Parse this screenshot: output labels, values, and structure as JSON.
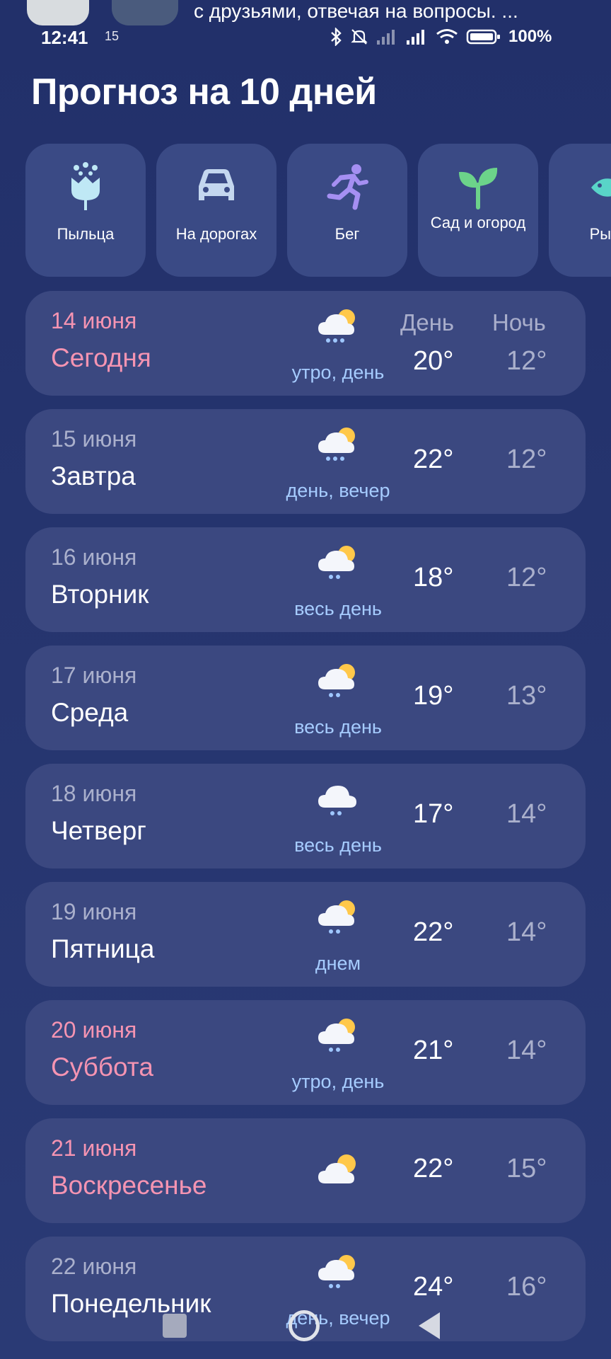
{
  "notification": {
    "text": "с друзьями, отвечая на вопросы. ..."
  },
  "status_bar": {
    "time": "12:41",
    "small": "15",
    "battery": "100%"
  },
  "title": "Прогноз на 10 дней",
  "tiles": [
    {
      "label": "Пыльца",
      "icon": "pollen-flower-icon"
    },
    {
      "label": "На дорогах",
      "icon": "car-icon"
    },
    {
      "label": "Бег",
      "icon": "runner-icon"
    },
    {
      "label": "Сад и огород",
      "icon": "sprout-icon"
    },
    {
      "label": "Рыба",
      "icon": "fish-icon"
    }
  ],
  "column_headers": {
    "day": "День",
    "night": "Ночь"
  },
  "days": [
    {
      "date": "14 июня",
      "name": "Сегодня",
      "period": "утро, день",
      "day_temp": "20°",
      "night_temp": "12°",
      "weekend": true,
      "icon": "cloud-sun-rain-icon"
    },
    {
      "date": "15 июня",
      "name": "Завтра",
      "period": "день, вечер",
      "day_temp": "22°",
      "night_temp": "12°",
      "weekend": false,
      "icon": "cloud-sun-rain-icon"
    },
    {
      "date": "16 июня",
      "name": "Вторник",
      "period": "весь день",
      "day_temp": "18°",
      "night_temp": "12°",
      "weekend": false,
      "icon": "cloud-sun-rain-icon"
    },
    {
      "date": "17 июня",
      "name": "Среда",
      "period": "весь день",
      "day_temp": "19°",
      "night_temp": "13°",
      "weekend": false,
      "icon": "cloud-sun-rain-icon"
    },
    {
      "date": "18 июня",
      "name": "Четверг",
      "period": "весь день",
      "day_temp": "17°",
      "night_temp": "14°",
      "weekend": false,
      "icon": "cloud-rain-icon"
    },
    {
      "date": "19 июня",
      "name": "Пятница",
      "period": "днем",
      "day_temp": "22°",
      "night_temp": "14°",
      "weekend": false,
      "icon": "cloud-sun-rain-icon"
    },
    {
      "date": "20 июня",
      "name": "Суббота",
      "period": "утро, день",
      "day_temp": "21°",
      "night_temp": "14°",
      "weekend": true,
      "icon": "cloud-sun-rain-icon"
    },
    {
      "date": "21 июня",
      "name": "Воскресенье",
      "period": "",
      "day_temp": "22°",
      "night_temp": "15°",
      "weekend": true,
      "icon": "cloud-sun-icon"
    },
    {
      "date": "22 июня",
      "name": "Понедельник",
      "period": "день, вечер",
      "day_temp": "24°",
      "night_temp": "16°",
      "weekend": false,
      "icon": "cloud-sun-rain-icon"
    }
  ]
}
